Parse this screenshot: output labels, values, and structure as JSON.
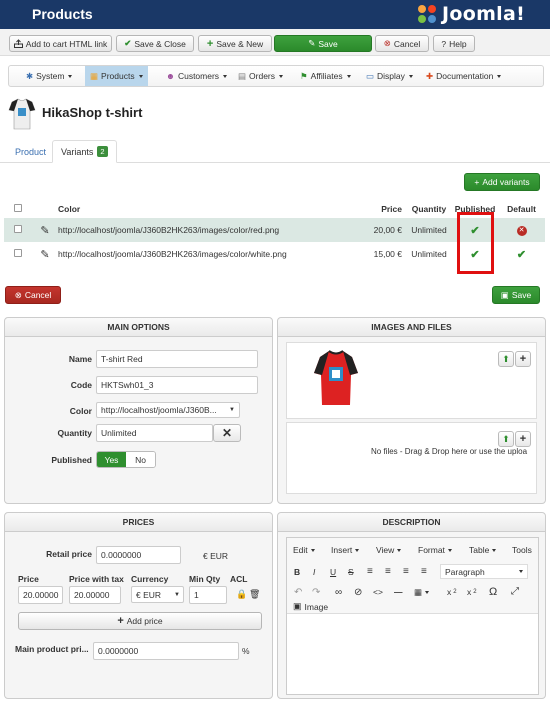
{
  "header": {
    "title": "Products",
    "brand": "Joomla!"
  },
  "toolbar": {
    "add_cart": "Add to cart HTML link",
    "save_close": "Save & Close",
    "save_new": "Save & New",
    "save": "Save",
    "cancel": "Cancel",
    "help": "Help"
  },
  "menu": {
    "system": "System",
    "products": "Products",
    "customers": "Customers",
    "orders": "Orders",
    "affiliates": "Affiliates",
    "display": "Display",
    "documentation": "Documentation"
  },
  "product": {
    "name": "HikaShop t-shirt"
  },
  "tabs": {
    "product": "Product",
    "variants": "Variants",
    "variants_count": "2"
  },
  "variants": {
    "add_label": "Add variants",
    "columns": {
      "color": "Color",
      "price": "Price",
      "quantity": "Quantity",
      "published": "Published",
      "default": "Default"
    },
    "rows": [
      {
        "color": "http://localhost/joomla/J360B2HK263/images/color/red.png",
        "price": "20,00 €",
        "quantity": "Unlimited"
      },
      {
        "color": "http://localhost/joomla/J360B2HK263/images/color/white.png",
        "price": "15,00 €",
        "quantity": "Unlimited"
      }
    ],
    "cancel": "Cancel",
    "save": "Save"
  },
  "main_options": {
    "title": "MAIN OPTIONS",
    "name_label": "Name",
    "name_value": "T-shirt Red",
    "code_label": "Code",
    "code_value": "HKTSwh01_3",
    "color_label": "Color",
    "color_value": "http://localhost/joomla/J360B...",
    "quantity_label": "Quantity",
    "quantity_value": "Unlimited",
    "published_label": "Published",
    "yes": "Yes",
    "no": "No"
  },
  "images_files": {
    "title": "IMAGES AND FILES",
    "files_msg": "No files - Drag & Drop here or use the uploa"
  },
  "prices": {
    "title": "PRICES",
    "retail_label": "Retail price",
    "retail_value": "0.0000000",
    "retail_unit": "€ EUR",
    "h_price": "Price",
    "h_pwt": "Price with tax",
    "h_currency": "Currency",
    "h_minqty": "Min Qty",
    "h_acl": "ACL",
    "price": "20.00000",
    "pwt": "20.00000",
    "currency": "€ EUR",
    "minqty": "1",
    "add_price": "Add price",
    "main_pri_label": "Main product pri...",
    "main_pri_value": "0.0000000",
    "main_pri_unit": "%"
  },
  "description": {
    "title": "DESCRIPTION",
    "edit": "Edit",
    "insert": "Insert",
    "view": "View",
    "format": "Format",
    "table": "Table",
    "tools": "Tools",
    "paragraph": "Paragraph",
    "image": "Image"
  },
  "colors": {
    "navy": "#1a3867",
    "green": "#2f8f2f",
    "red": "#b92c25",
    "highlight": "#dbe8e3"
  }
}
